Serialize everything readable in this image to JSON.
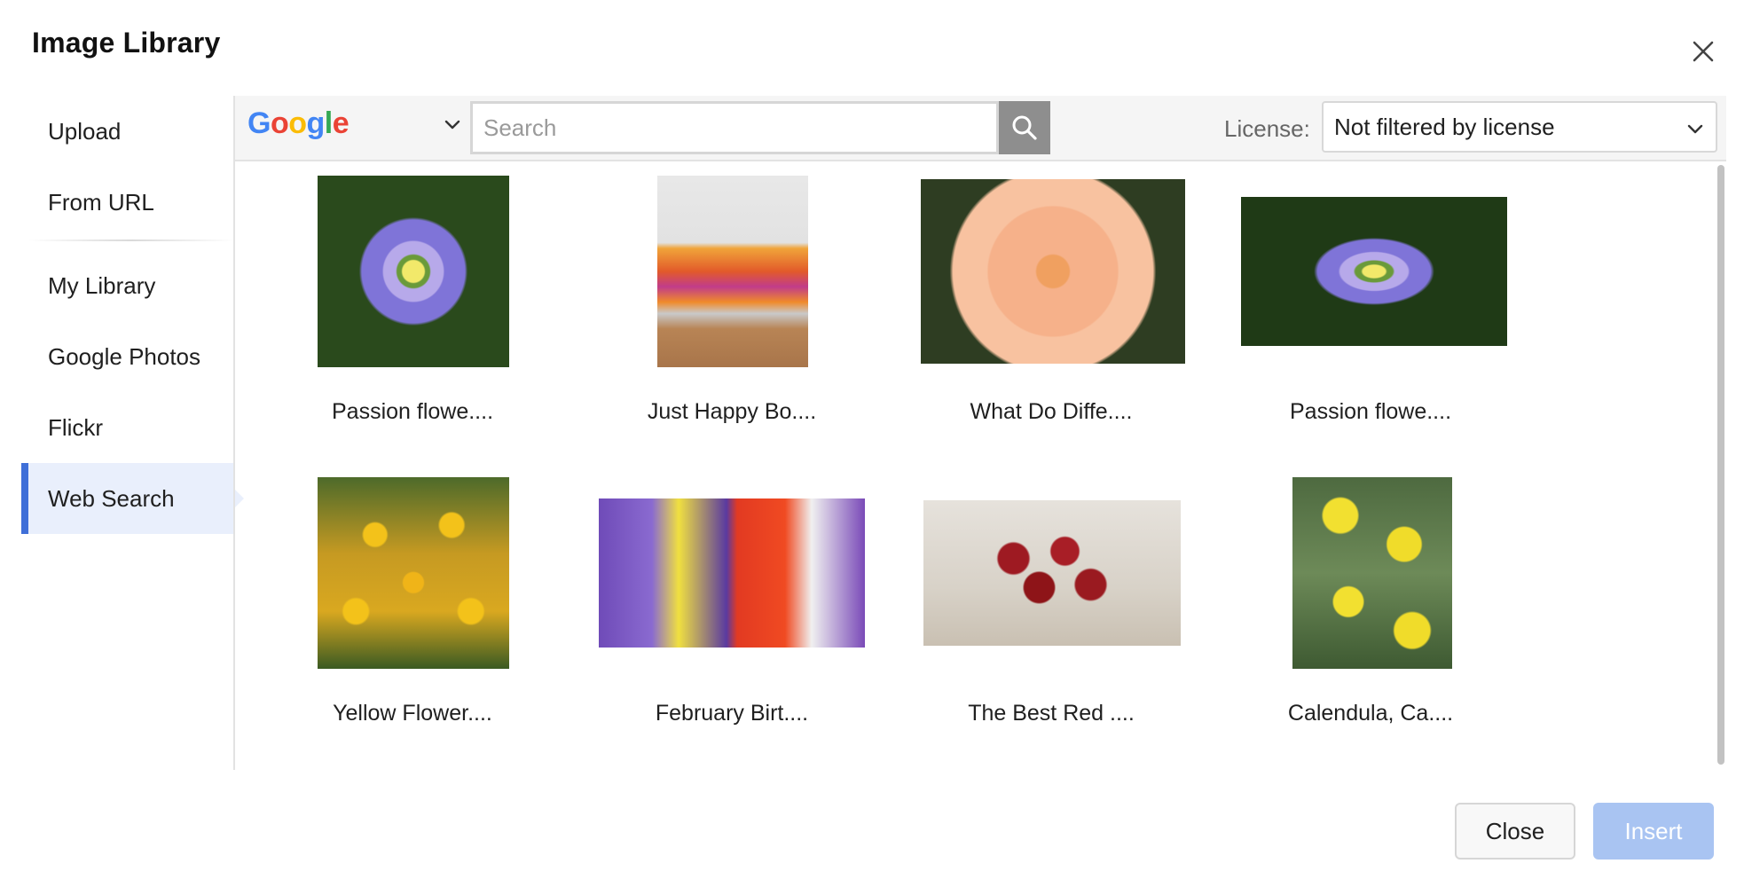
{
  "dialog": {
    "title": "Image Library"
  },
  "sidebar": {
    "items": [
      {
        "label": "Upload"
      },
      {
        "label": "From URL"
      },
      {
        "label": "My Library"
      },
      {
        "label": "Google Photos"
      },
      {
        "label": "Flickr"
      },
      {
        "label": "Web Search",
        "active": true
      }
    ]
  },
  "toolbar": {
    "engine": {
      "label": "Google",
      "icon": "google-logo",
      "colors": [
        "#4285F4",
        "#EA4335",
        "#FBBC05",
        "#4285F4",
        "#34A853",
        "#EA4335"
      ]
    },
    "search": {
      "value": "",
      "placeholder": "Search",
      "icon": "search-icon"
    },
    "license": {
      "label": "License:",
      "selected": "Not filtered by license",
      "icon": "chevron-down-icon"
    }
  },
  "images": [
    {
      "caption": "Passion flowe...."
    },
    {
      "caption": "Just Happy Bo...."
    },
    {
      "caption": "What Do Diffe...."
    },
    {
      "caption": "Passion flowe...."
    },
    {
      "caption": "Yellow Flower...."
    },
    {
      "caption": "February Birt...."
    },
    {
      "caption": "The Best Red ...."
    },
    {
      "caption": "Calendula, Ca...."
    }
  ],
  "footer": {
    "close_label": "Close",
    "insert_label": "Insert"
  },
  "colors": {
    "accent": "#3f6fd8",
    "active_bg": "#e9effc",
    "insert_disabled": "#a9c4f2",
    "search_button": "#8e8e8e"
  }
}
